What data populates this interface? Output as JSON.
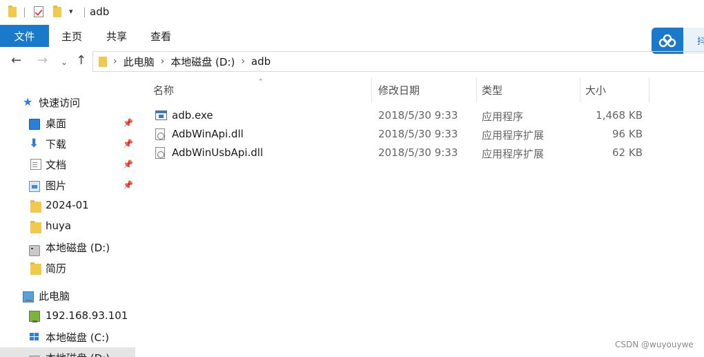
{
  "window": {
    "title": "adb"
  },
  "ribbon": {
    "tabs": [
      {
        "label": "文件"
      },
      {
        "label": "主页"
      },
      {
        "label": "共享"
      },
      {
        "label": "查看"
      }
    ]
  },
  "cloud": {
    "side_text": "抖"
  },
  "address": {
    "breadcrumbs": [
      "此电脑",
      "本地磁盘 (D:)",
      "adb"
    ]
  },
  "sidebar": {
    "quick_access": "快速访问",
    "items": [
      {
        "label": "桌面",
        "icon": "desktop-icon",
        "pinned": true
      },
      {
        "label": "下载",
        "icon": "download-icon",
        "pinned": true
      },
      {
        "label": "文档",
        "icon": "document-icon",
        "pinned": true
      },
      {
        "label": "图片",
        "icon": "picture-icon",
        "pinned": true
      },
      {
        "label": "2024-01",
        "icon": "folder-icon",
        "pinned": false
      },
      {
        "label": "huya",
        "icon": "folder-icon",
        "pinned": false
      },
      {
        "label": "本地磁盘 (D:)",
        "icon": "drive-icon",
        "pinned": false
      },
      {
        "label": "简历",
        "icon": "folder-icon",
        "pinned": false
      }
    ],
    "this_pc": "此电脑",
    "pc_items": [
      {
        "label": "192.168.93.101",
        "icon": "network-drive-icon"
      },
      {
        "label": "本地磁盘 (C:)",
        "icon": "windows-drive-icon"
      },
      {
        "label": "本地磁盘 (D:)",
        "icon": "drive-icon"
      }
    ]
  },
  "columns": {
    "name": "名称",
    "date": "修改日期",
    "type": "类型",
    "size": "大小"
  },
  "files": [
    {
      "name": "adb.exe",
      "date": "2018/5/30 9:33",
      "type": "应用程序",
      "size": "1,468 KB",
      "icon": "exe-icon"
    },
    {
      "name": "AdbWinApi.dll",
      "date": "2018/5/30 9:33",
      "type": "应用程序扩展",
      "size": "96 KB",
      "icon": "dll-icon"
    },
    {
      "name": "AdbWinUsbApi.dll",
      "date": "2018/5/30 9:33",
      "type": "应用程序扩展",
      "size": "62 KB",
      "icon": "dll-icon"
    }
  ],
  "watermark": "CSDN @wuyouywe",
  "colors": {
    "accent": "#1979ca",
    "folder": "#f2c94c"
  }
}
